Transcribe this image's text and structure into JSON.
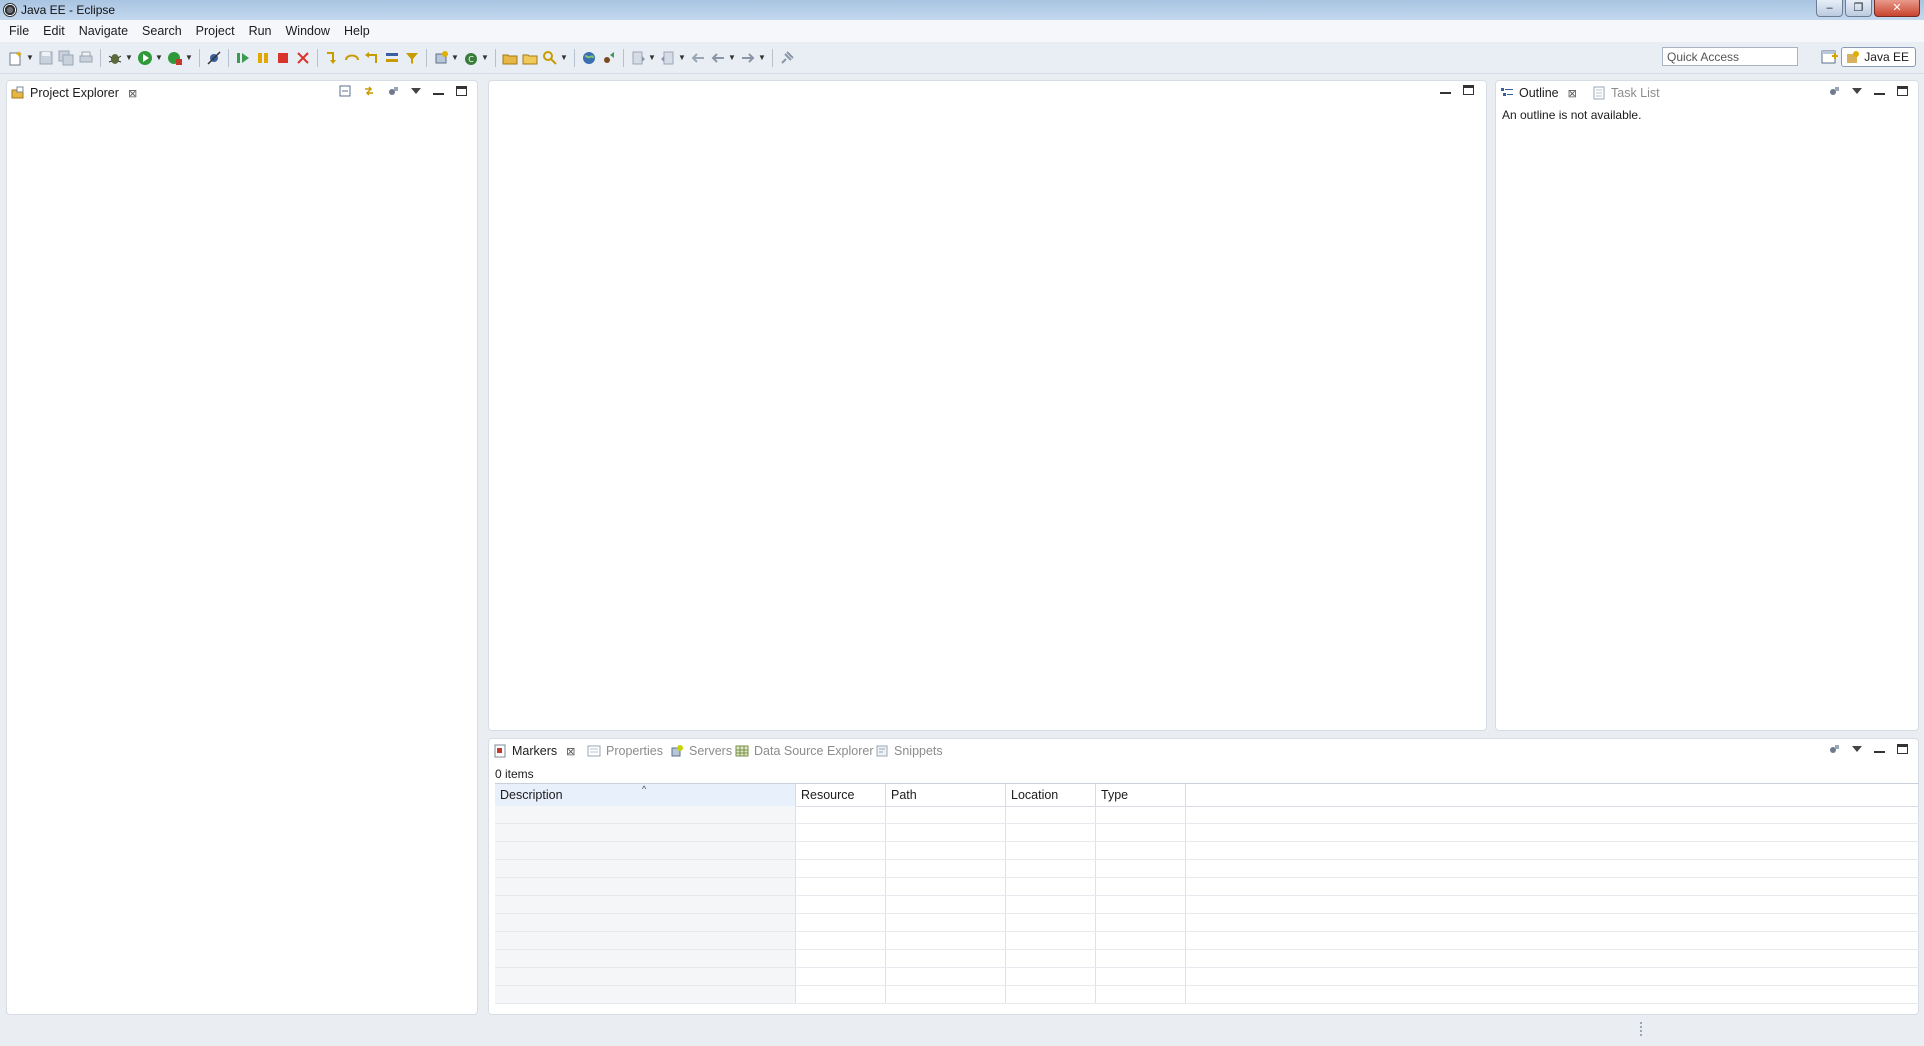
{
  "window": {
    "title": "Java EE - Eclipse",
    "controls": {
      "minimize": "–",
      "restore": "❐",
      "close": "✕"
    }
  },
  "menu": [
    "File",
    "Edit",
    "Navigate",
    "Search",
    "Project",
    "Run",
    "Window",
    "Help"
  ],
  "toolbar": {
    "quick_access_placeholder": "Quick Access",
    "perspective": "Java EE",
    "icons": [
      "new-icon",
      "save-icon",
      "save-all-icon",
      "print-icon",
      "debug-icon",
      "run-icon",
      "external-tools-icon",
      "skip-breakpoints-icon",
      "resume-icon",
      "suspend-icon",
      "terminate-icon",
      "disconnect-icon",
      "step-into-icon",
      "step-over-icon",
      "step-return-icon",
      "drop-to-frame-icon",
      "use-step-filters-icon",
      "new-server-icon",
      "new-java-class-icon",
      "open-type-icon",
      "open-task-icon",
      "search-icon",
      "open-web-browser-icon",
      "ant-icon",
      "next-annotation-icon",
      "previous-annotation-icon",
      "last-edit-location-icon",
      "back-icon",
      "forward-icon",
      "pin-editor-icon"
    ]
  },
  "project_explorer": {
    "tab_label": "Project Explorer"
  },
  "outline": {
    "tabs": [
      {
        "label": "Outline",
        "active": true
      },
      {
        "label": "Task List",
        "active": false
      }
    ],
    "message": "An outline is not available."
  },
  "bottom": {
    "tabs": [
      {
        "label": "Markers",
        "active": true
      },
      {
        "label": "Properties",
        "active": false
      },
      {
        "label": "Servers",
        "active": false
      },
      {
        "label": "Data Source Explorer",
        "active": false
      },
      {
        "label": "Snippets",
        "active": false
      }
    ],
    "items_count": "0 items",
    "columns": [
      "Description",
      "Resource",
      "Path",
      "Location",
      "Type"
    ],
    "row_count": 11
  },
  "colors": {
    "titlebar": "#b8cfe9",
    "background": "#eaeef3",
    "panel": "#ffffff",
    "accent": "#1f5fa8"
  }
}
